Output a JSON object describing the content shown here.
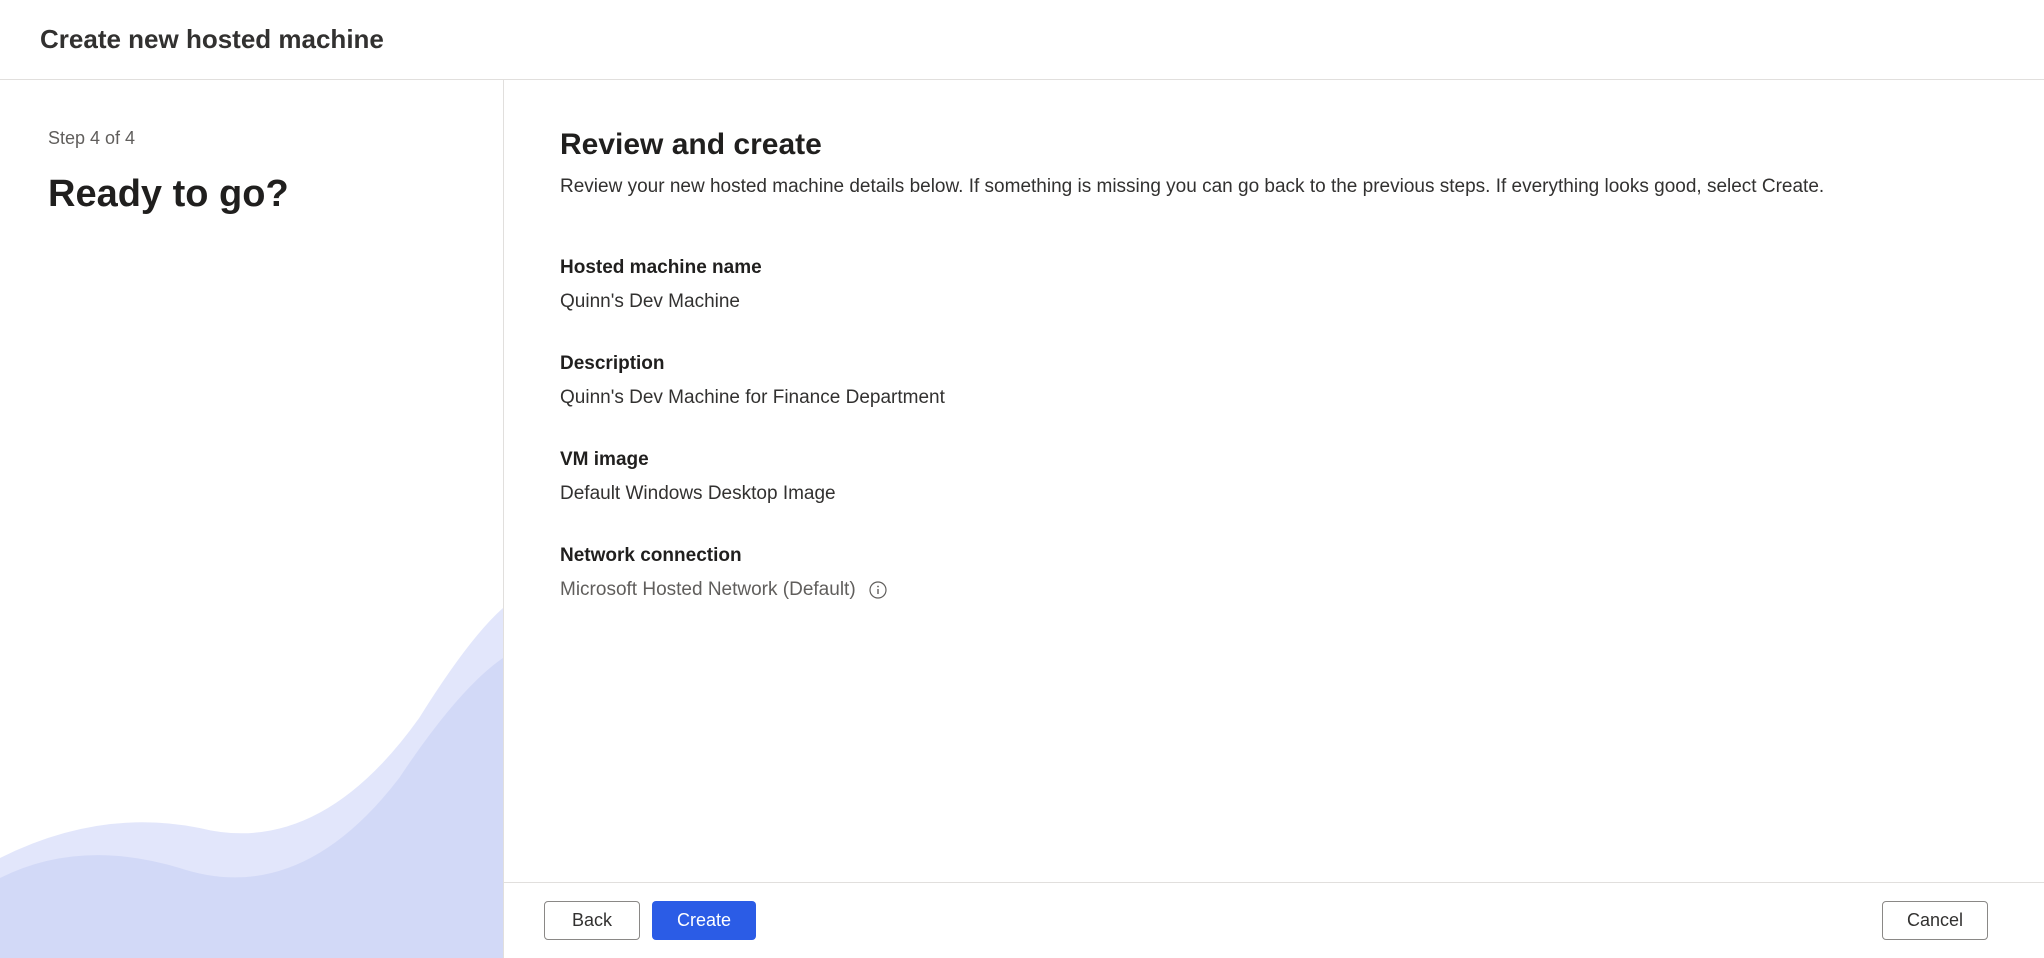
{
  "header": {
    "title": "Create new hosted machine"
  },
  "sidebar": {
    "step_indicator": "Step 4 of 4",
    "title": "Ready to go?"
  },
  "main": {
    "title": "Review and create",
    "description": "Review your new hosted machine details below. If something is missing you can go back to the previous steps. If everything looks good, select Create.",
    "fields": {
      "hosted_machine_name": {
        "label": "Hosted machine name",
        "value": "Quinn's Dev Machine"
      },
      "description": {
        "label": "Description",
        "value": "Quinn's Dev Machine for Finance Department"
      },
      "vm_image": {
        "label": "VM image",
        "value": "Default Windows Desktop Image"
      },
      "network_connection": {
        "label": "Network connection",
        "value": "Microsoft Hosted Network (Default)"
      }
    }
  },
  "footer": {
    "back_label": "Back",
    "create_label": "Create",
    "cancel_label": "Cancel"
  }
}
